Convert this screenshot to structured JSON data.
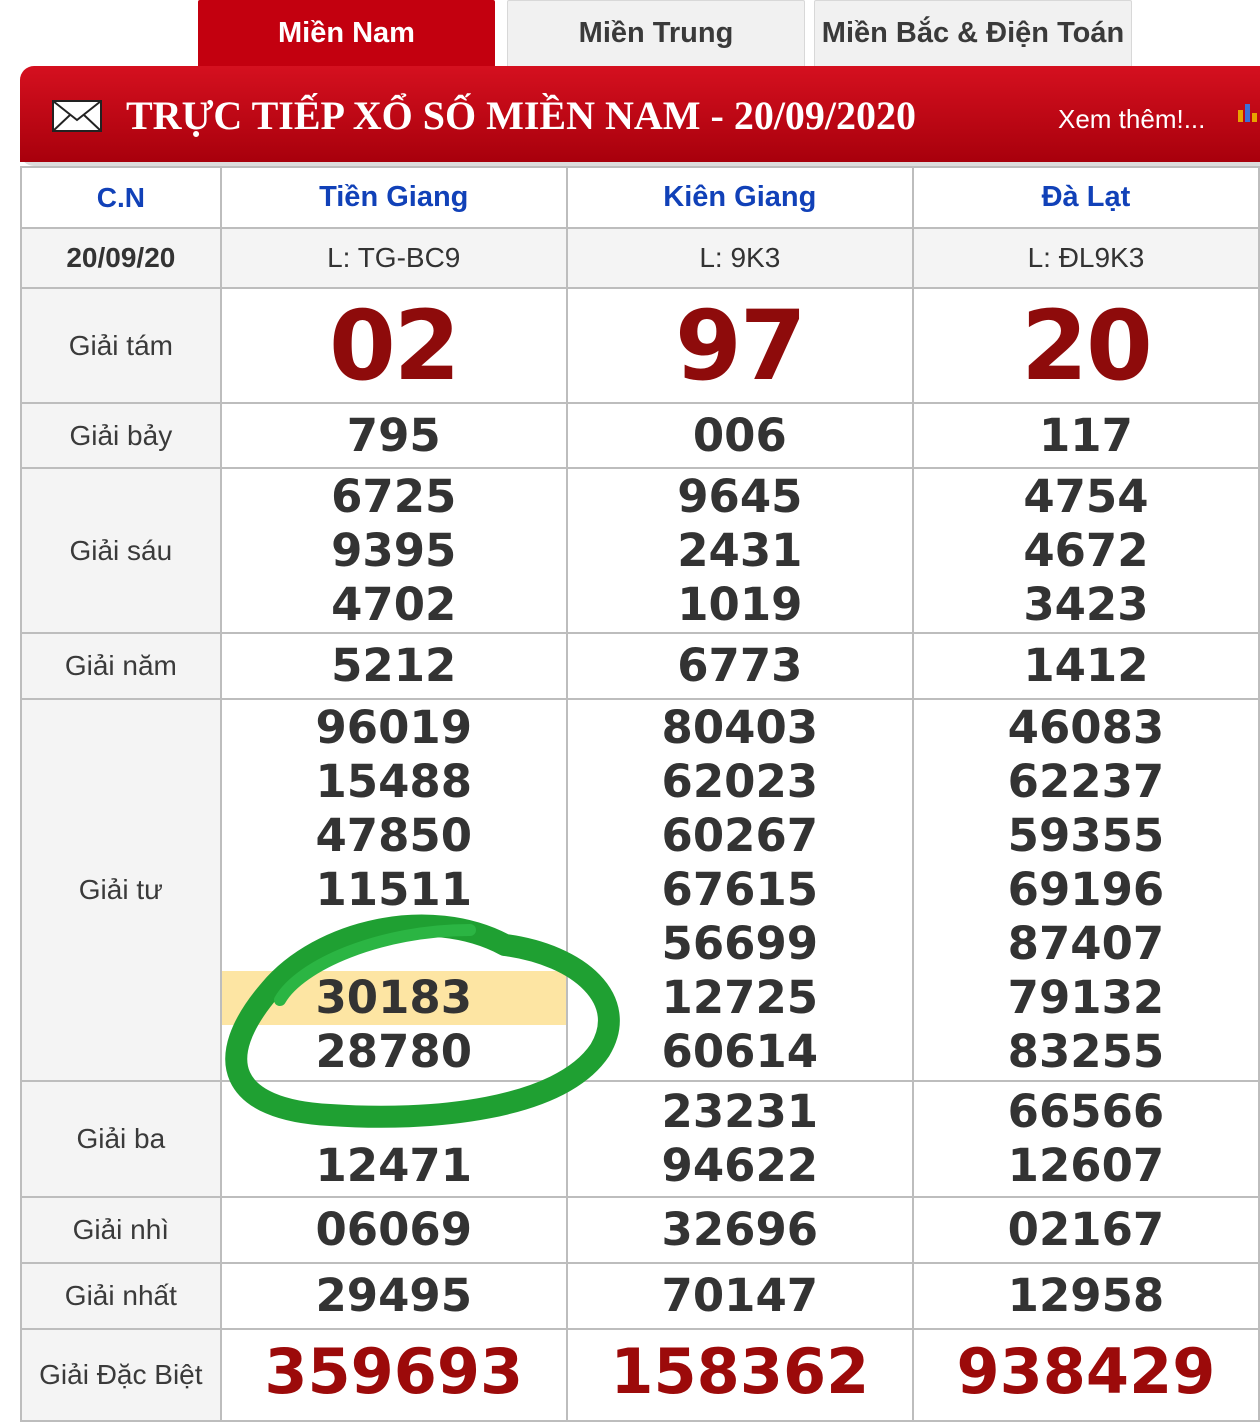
{
  "tabs": [
    {
      "label": "Miền Nam",
      "active": true
    },
    {
      "label": "Miền Trung",
      "active": false
    },
    {
      "label": "Miền Bắc & Điện Toán",
      "active": false
    }
  ],
  "header": {
    "title": "TRỰC TIẾP XỔ SỐ MIỀN NAM - 20/09/2020",
    "more_link": "Xem thêm!...",
    "envelope_icon": "mail-icon",
    "chart_icon": "bar-chart-icon"
  },
  "table": {
    "day_label": "C.N",
    "date": "20/09/20",
    "provinces": [
      {
        "name": "Tiền Giang",
        "code": "L: TG-BC9"
      },
      {
        "name": "Kiên Giang",
        "code": "L: 9K3"
      },
      {
        "name": "Đà Lạt",
        "code": "L: ĐL9K3"
      }
    ],
    "prizes": {
      "g8": {
        "label": "Giải tám",
        "values": [
          "02",
          "97",
          "20"
        ]
      },
      "g7": {
        "label": "Giải bảy",
        "values": [
          "795",
          "006",
          "117"
        ]
      },
      "g6": {
        "label": "Giải sáu",
        "values": [
          [
            "6725",
            "9395",
            "4702"
          ],
          [
            "9645",
            "2431",
            "1019"
          ],
          [
            "4754",
            "4672",
            "3423"
          ]
        ]
      },
      "g5": {
        "label": "Giải năm",
        "values": [
          "5212",
          "6773",
          "1412"
        ]
      },
      "g4": {
        "label": "Giải tư",
        "values": [
          [
            "96019",
            "15488",
            "47850",
            "11511",
            "",
            "30183",
            "28780"
          ],
          [
            "80403",
            "62023",
            "60267",
            "67615",
            "56699",
            "12725",
            "60614"
          ],
          [
            "46083",
            "62237",
            "59355",
            "69196",
            "87407",
            "79132",
            "83255"
          ]
        ]
      },
      "g3": {
        "label": "Giải ba",
        "values": [
          [
            "",
            "12471"
          ],
          [
            "23231",
            "94622"
          ],
          [
            "66566",
            "12607"
          ]
        ]
      },
      "g2": {
        "label": "Giải nhì",
        "values": [
          "06069",
          "32696",
          "02167"
        ]
      },
      "g1": {
        "label": "Giải nhất",
        "values": [
          "29495",
          "70147",
          "12958"
        ]
      },
      "db": {
        "label": "Giải Đặc Biệt",
        "values": [
          "359693",
          "158362",
          "938429"
        ]
      }
    }
  },
  "colors": {
    "accent": "#c3000f",
    "province": "#1141b8",
    "highlight": "#fde5a3",
    "scribble": "#1fa032"
  }
}
